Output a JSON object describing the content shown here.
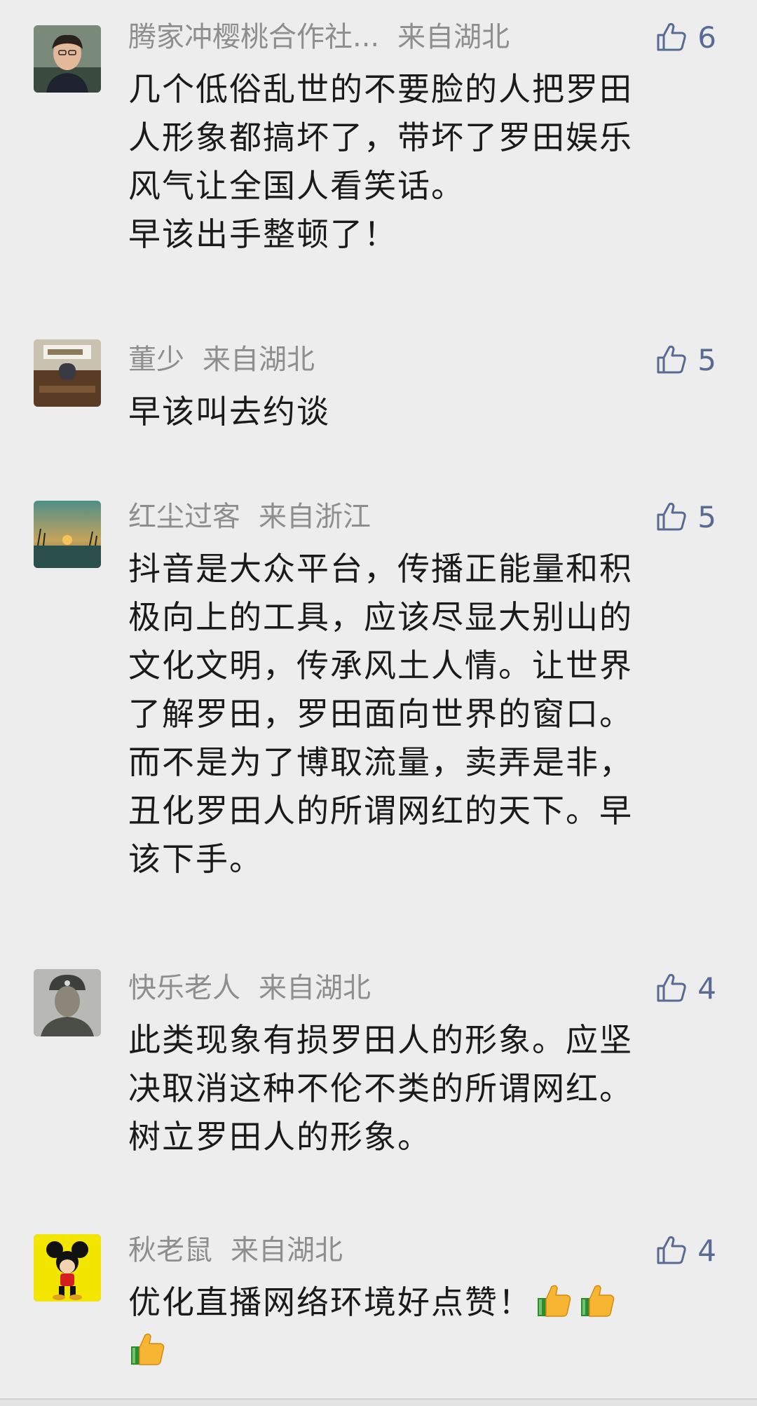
{
  "comments": [
    {
      "name": "腾家冲樱桃合作社...",
      "location": "来自湖北",
      "likes": "6",
      "text": "几个低俗乱世的不要脸的人把罗田\n人形象都搞坏了，带坏了罗田娱乐\n风气让全国人看笑话。\n早该出手整顿了！",
      "avatar": "person-avatar"
    },
    {
      "name": "董少",
      "location": "来自湖北",
      "likes": "5",
      "text": "早该叫去约谈",
      "avatar": "office-avatar"
    },
    {
      "name": "红尘过客",
      "location": "来自浙江",
      "likes": "5",
      "text": "抖音是大众平台，传播正能量和积\n极向上的工具，应该尽显大别山的\n文化文明，传承风土人情。让世界\n了解罗田，罗田面向世界的窗口。\n而不是为了博取流量，卖弄是非，\n丑化罗田人的所谓网红的天下。早\n该下手。",
      "avatar": "sunset-avatar"
    },
    {
      "name": "快乐老人",
      "location": "来自湖北",
      "likes": "4",
      "text": "此类现象有损罗田人的形象。应坚\n决取消这种不伦不类的所谓网红。\n树立罗田人的形象。",
      "avatar": "soldier-avatar"
    },
    {
      "name": "秋老鼠",
      "location": "来自湖北",
      "likes": "4",
      "text": "优化直播网络环境好点赞！",
      "emoji_count": 3,
      "avatar": "mickey-avatar"
    }
  ],
  "colors": {
    "background": "#ededed",
    "meta_gray": "#8e8e8e",
    "like_blue": "#576b95",
    "text": "#1a1a1a"
  }
}
